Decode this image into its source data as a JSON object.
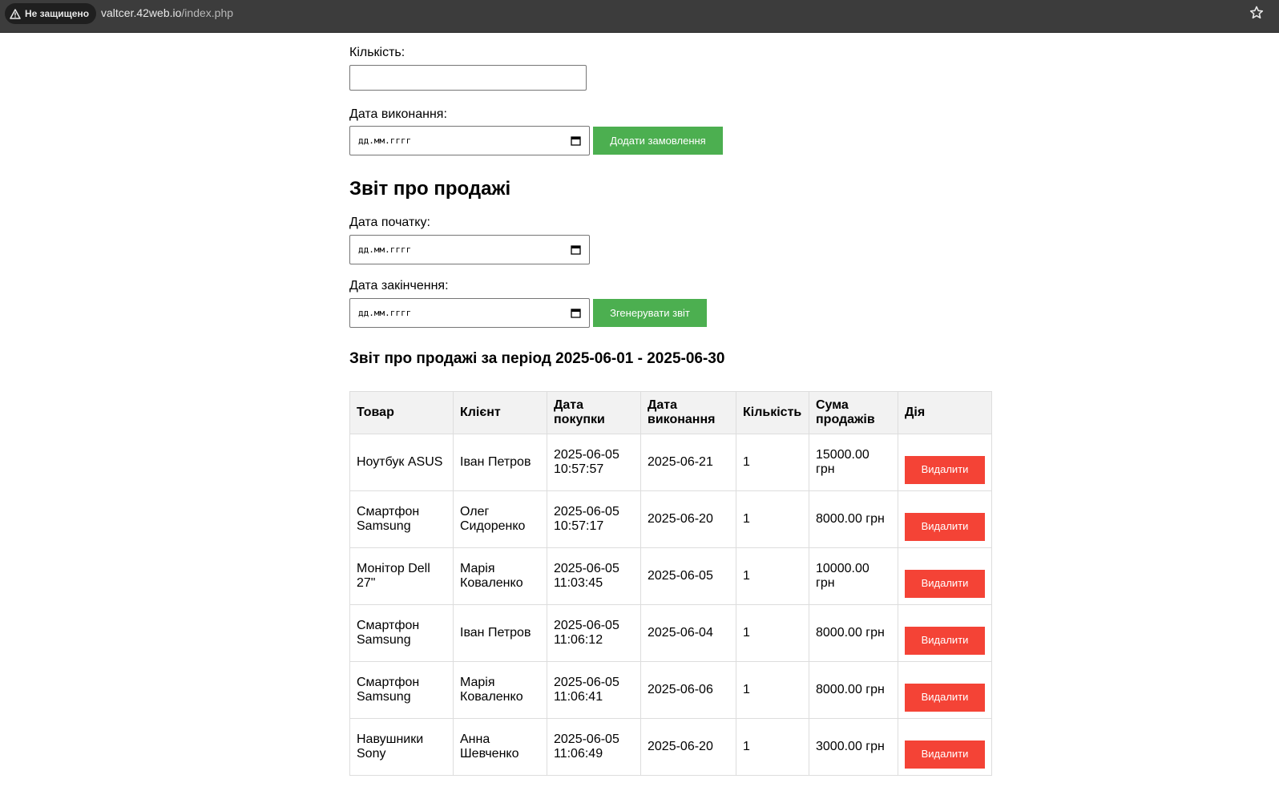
{
  "browser": {
    "security_label": "Не защищено",
    "url_host": "valtcer.42web.io",
    "url_path": "/index.php"
  },
  "order_form": {
    "quantity_label": "Кількість:",
    "quantity_value": "",
    "due_date_label": "Дата виконання:",
    "due_date_placeholder": "дд.мм.гггг",
    "add_button": "Додати замовлення"
  },
  "report_form": {
    "heading": "Звіт про продажі",
    "start_label": "Дата початку:",
    "start_placeholder": "дд.мм.гггг",
    "end_label": "Дата закінчення:",
    "end_placeholder": "дд.мм.гггг",
    "generate_button": "Згенерувати звіт"
  },
  "report": {
    "title": "Звіт про продажі за період 2025-06-01 - 2025-06-30",
    "columns": [
      "Товар",
      "Клієнт",
      "Дата покупки",
      "Дата виконання",
      "Кількість",
      "Сума продажів",
      "Дія"
    ],
    "rows": [
      {
        "product": "Ноутбук ASUS",
        "client": "Іван Петров",
        "purchase_date": "2025-06-05 10:57:57",
        "due_date": "2025-06-21",
        "quantity": "1",
        "amount": "15000.00 грн",
        "action": "Видалити"
      },
      {
        "product": "Смартфон Samsung",
        "client": "Олег Сидоренко",
        "purchase_date": "2025-06-05 10:57:17",
        "due_date": "2025-06-20",
        "quantity": "1",
        "amount": "8000.00 грн",
        "action": "Видалити"
      },
      {
        "product": "Монітор Dell 27\"",
        "client": "Марія Коваленко",
        "purchase_date": "2025-06-05 11:03:45",
        "due_date": "2025-06-05",
        "quantity": "1",
        "amount": "10000.00 грн",
        "action": "Видалити"
      },
      {
        "product": "Смартфон Samsung",
        "client": "Іван Петров",
        "purchase_date": "2025-06-05 11:06:12",
        "due_date": "2025-06-04",
        "quantity": "1",
        "amount": "8000.00 грн",
        "action": "Видалити"
      },
      {
        "product": "Смартфон Samsung",
        "client": "Марія Коваленко",
        "purchase_date": "2025-06-05 11:06:41",
        "due_date": "2025-06-06",
        "quantity": "1",
        "amount": "8000.00 грн",
        "action": "Видалити"
      },
      {
        "product": "Навушники Sony",
        "client": "Анна Шевченко",
        "purchase_date": "2025-06-05 11:06:49",
        "due_date": "2025-06-20",
        "quantity": "1",
        "amount": "3000.00 грн",
        "action": "Видалити"
      }
    ]
  },
  "colors": {
    "green_button": "#4caf50",
    "red_button": "#f44336",
    "header_bg": "#f2f2f2"
  }
}
